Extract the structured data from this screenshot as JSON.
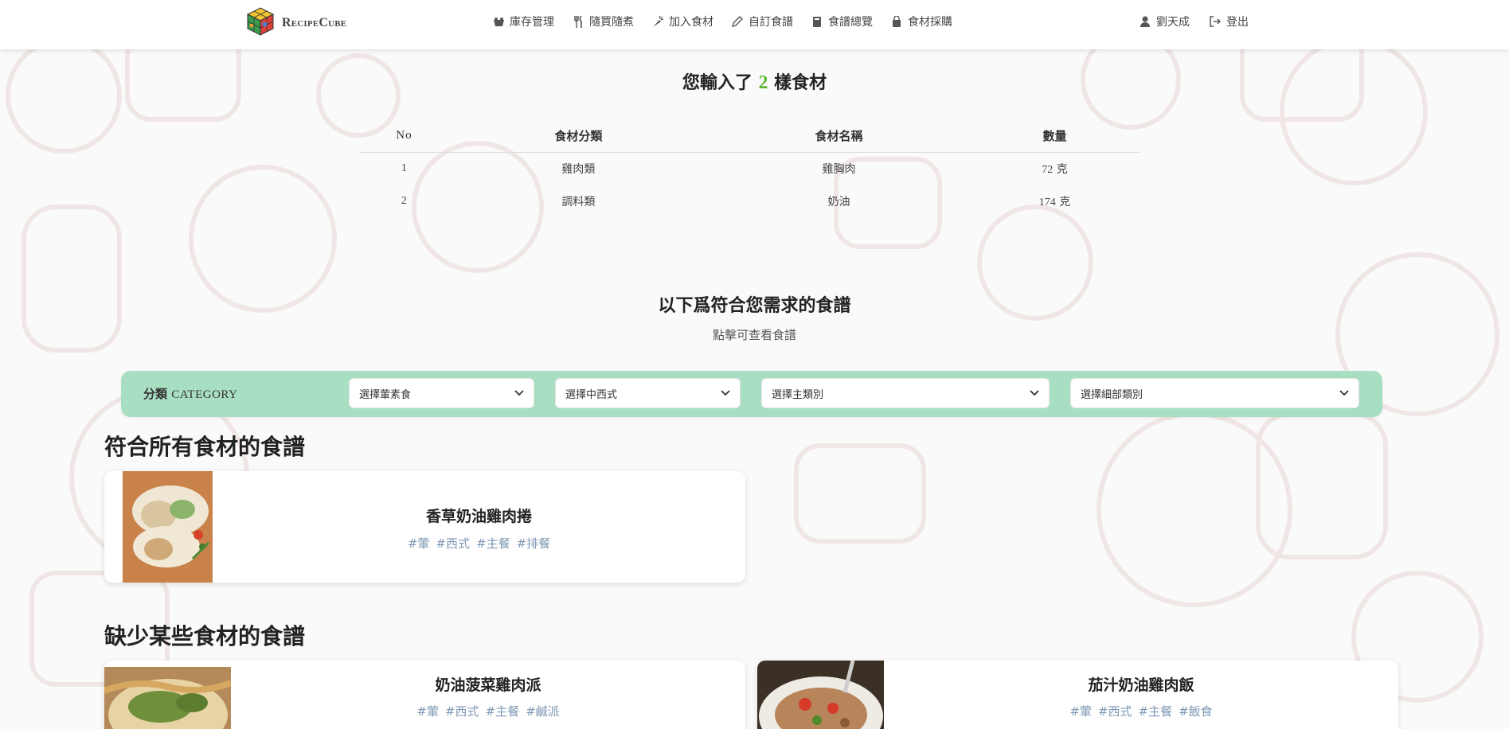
{
  "brand": {
    "name": "RecipeCube"
  },
  "nav": {
    "links": [
      {
        "label": "庫存管理",
        "icon": "basket-icon"
      },
      {
        "label": "隨買隨煮",
        "icon": "utensils-icon"
      },
      {
        "label": "加入食材",
        "icon": "carrot-icon"
      },
      {
        "label": "自訂食譜",
        "icon": "pencil-icon"
      },
      {
        "label": "食譜總覽",
        "icon": "book-icon"
      },
      {
        "label": "食材採購",
        "icon": "shopping-bag-icon"
      }
    ],
    "user": {
      "label": "劉天成",
      "icon": "user-icon"
    },
    "logout": {
      "label": "登出",
      "icon": "logout-icon"
    }
  },
  "summary": {
    "prefix": "您輸入了",
    "count": "2",
    "suffix": "樣食材"
  },
  "ingredients_table": {
    "headers": [
      "No",
      "食材分類",
      "食材名稱",
      "數量"
    ],
    "rows": [
      {
        "no": "1",
        "category": "雞肉類",
        "name": "雞胸肉",
        "qty": "72",
        "unit": "克"
      },
      {
        "no": "2",
        "category": "調料類",
        "name": "奶油",
        "qty": "174",
        "unit": "克"
      }
    ]
  },
  "recipes_header": {
    "title": "以下爲符合您需求的食譜",
    "hint": "點擊可查看食譜"
  },
  "category_filter": {
    "label_zh": "分類",
    "label_en": "CATEGORY",
    "selects": [
      {
        "value": "選擇葷素食"
      },
      {
        "value": "選擇中西式"
      },
      {
        "value": "選擇主類別"
      },
      {
        "value": "選擇細部類別"
      }
    ]
  },
  "sections": {
    "all_match": {
      "title": "符合所有食材的食譜",
      "recipes": [
        {
          "name": "香草奶油雞肉捲",
          "tags": [
            "#葷",
            "#西式",
            "#主餐",
            "#排餐"
          ]
        }
      ]
    },
    "missing": {
      "title": "缺少某些食材的食譜",
      "recipes": [
        {
          "name": "奶油菠菜雞肉派",
          "tags": [
            "#葷",
            "#西式",
            "#主餐",
            "#鹹派"
          ]
        },
        {
          "name": "茄汁奶油雞肉飯",
          "tags": [
            "#葷",
            "#西式",
            "#主餐",
            "#飯食"
          ]
        }
      ]
    }
  },
  "colors": {
    "accent_green": "#5cb832",
    "category_bar": "#a8dfc2",
    "tag_blue": "#7f98b4"
  }
}
